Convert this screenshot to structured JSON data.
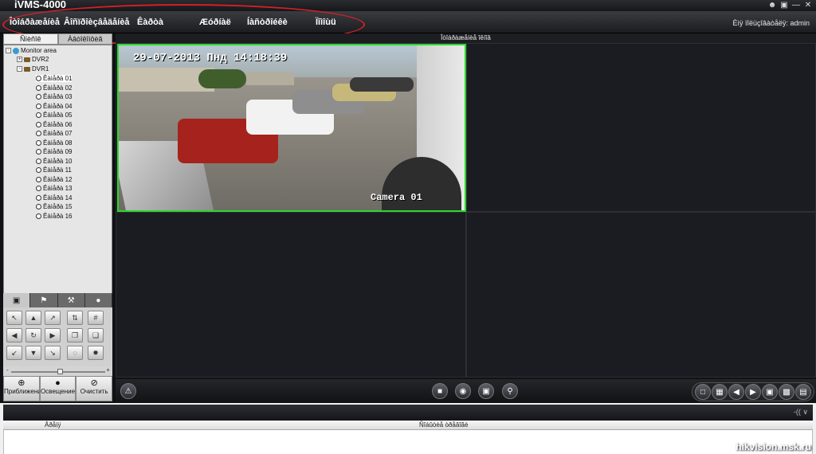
{
  "app": {
    "title": "iVMS-4000"
  },
  "window_controls": [
    "user-icon",
    "lock-icon",
    "minimize-icon",
    "close-icon"
  ],
  "menu": {
    "items": [
      "Îòîáðàæåíèå",
      "Âîñïðîèçâåäåíèå",
      "Êàðòà",
      "Æóðíàë",
      "Íàñòðîéêè",
      "Ïîìîùü"
    ],
    "active_index": 0
  },
  "user": {
    "label": "Èìÿ ïîëüçîâàòåëÿ: admin"
  },
  "left_panel": {
    "tabs": [
      "Ñïèñîê",
      "Àâòîêîíôèã"
    ],
    "selected_tab": 0,
    "tree": {
      "root": "Monitor area",
      "nodes": [
        {
          "label": "DVR2",
          "expanded": false
        },
        {
          "label": "DVR1",
          "expanded": true
        }
      ],
      "cameras": [
        "Êàìåðà 01",
        "Êàìåðà 02",
        "Êàìåðà 03",
        "Êàìåðà 04",
        "Êàìåðà 05",
        "Êàìåðà 06",
        "Êàìåðà 07",
        "Êàìåðà 08",
        "Êàìåðà 09",
        "Êàìåðà 10",
        "Êàìåðà 11",
        "Êàìåðà 12",
        "Êàìåðà 13",
        "Êàìåðà 14",
        "Êàìåðà 15",
        "Êàìåðà 16"
      ]
    },
    "panel_tabs": [
      "ptz-icon",
      "flag-icon",
      "tools-icon",
      "record-icon"
    ],
    "ptz_buttons": [
      "up-left",
      "up",
      "up-right",
      "zoom-in",
      "grid",
      "left",
      "auto",
      "right",
      "copy",
      "paste",
      "down-left",
      "down",
      "down-right",
      "focus",
      "iris"
    ],
    "slider": {
      "min_label": "-",
      "max_label": "+",
      "value": 0.5
    },
    "bottom_buttons": [
      "Приближение",
      "Освещение",
      "Очистить"
    ]
  },
  "video": {
    "header": "Îòîáðàæåíèå îêíîâ",
    "osd_datetime": "29-07-2013 Пнд 14:18:39",
    "osd_camera": "Camera 01"
  },
  "controls": {
    "left": [
      "alarm-icon"
    ],
    "center": [
      "stop-all-icon",
      "record-icon",
      "snapshot-icon",
      "zoom-icon"
    ],
    "right": [
      "layout-1-icon",
      "layout-4-icon",
      "prev-icon",
      "next-icon",
      "fullscreen-icon",
      "save-view-icon",
      "exit-icon"
    ]
  },
  "events": {
    "columns": [
      "Âðåìÿ",
      "Ñîáûòèå òðåâîãè"
    ],
    "icons": "-(( ∨"
  },
  "watermark": "hikvision.msk.ru",
  "colors": {
    "active_border": "#2bd92b",
    "highlight": "#d0202a"
  }
}
